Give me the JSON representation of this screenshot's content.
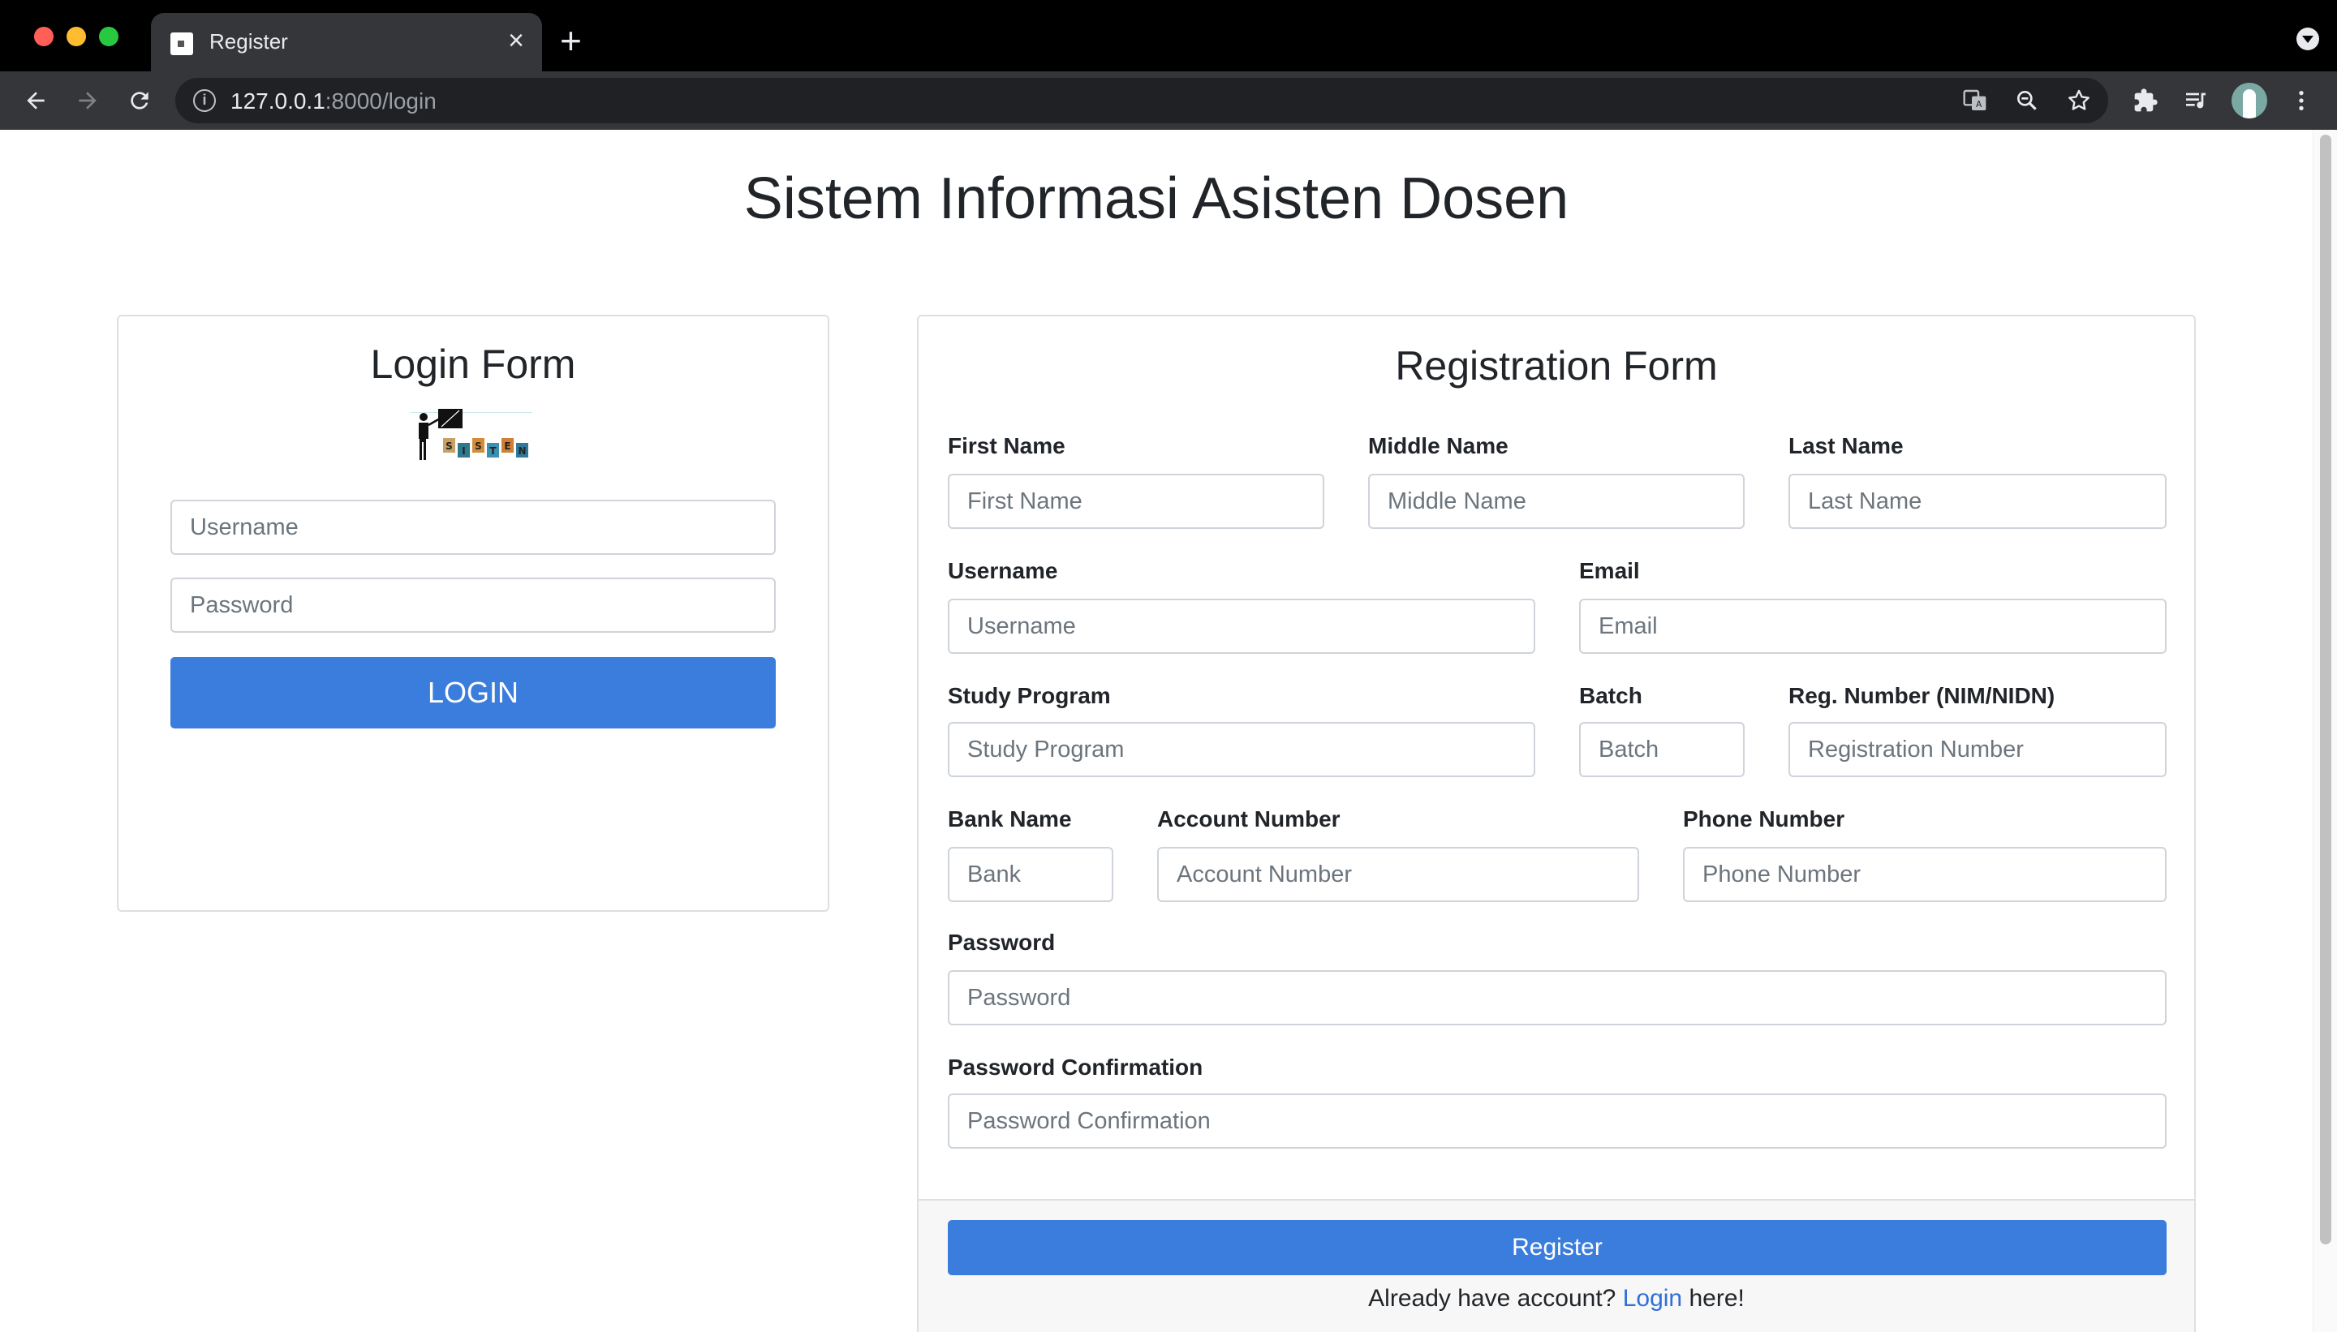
{
  "browser": {
    "tab_title": "Register",
    "tab_close": "×",
    "new_tab": "+",
    "url_host": "127.0.0.1",
    "url_path": ":8000/login"
  },
  "page": {
    "title": "Sistem Informasi Asisten Dosen"
  },
  "login": {
    "title": "Login Form",
    "logo_text": "SISTEN",
    "username_placeholder": "Username",
    "password_placeholder": "Password",
    "button": "LOGIN"
  },
  "register": {
    "title": "Registration Form",
    "first_name_label": "First Name",
    "first_name_placeholder": "First Name",
    "middle_name_label": "Middle Name",
    "middle_name_placeholder": "Middle Name",
    "last_name_label": "Last Name",
    "last_name_placeholder": "Last Name",
    "username_label": "Username",
    "username_placeholder": "Username",
    "email_label": "Email",
    "email_placeholder": "Email",
    "study_program_label": "Study Program",
    "study_program_placeholder": "Study Program",
    "batch_label": "Batch",
    "batch_placeholder": "Batch",
    "reg_number_label": "Reg. Number (NIM/NIDN)",
    "reg_number_placeholder": "Registration Number",
    "bank_label": "Bank Name",
    "bank_placeholder": "Bank",
    "account_label": "Account Number",
    "account_placeholder": "Account Number",
    "phone_label": "Phone Number",
    "phone_placeholder": "Phone Number",
    "password_label": "Password",
    "password_placeholder": "Password",
    "password_confirm_label": "Password Confirmation",
    "password_confirm_placeholder": "Password Confirmation",
    "button": "Register",
    "footer_prefix": "Already have account?",
    "footer_link": "Login",
    "footer_suffix": "here!"
  },
  "colors": {
    "primary": "#3b7ddd",
    "link": "#2f6fd9"
  }
}
